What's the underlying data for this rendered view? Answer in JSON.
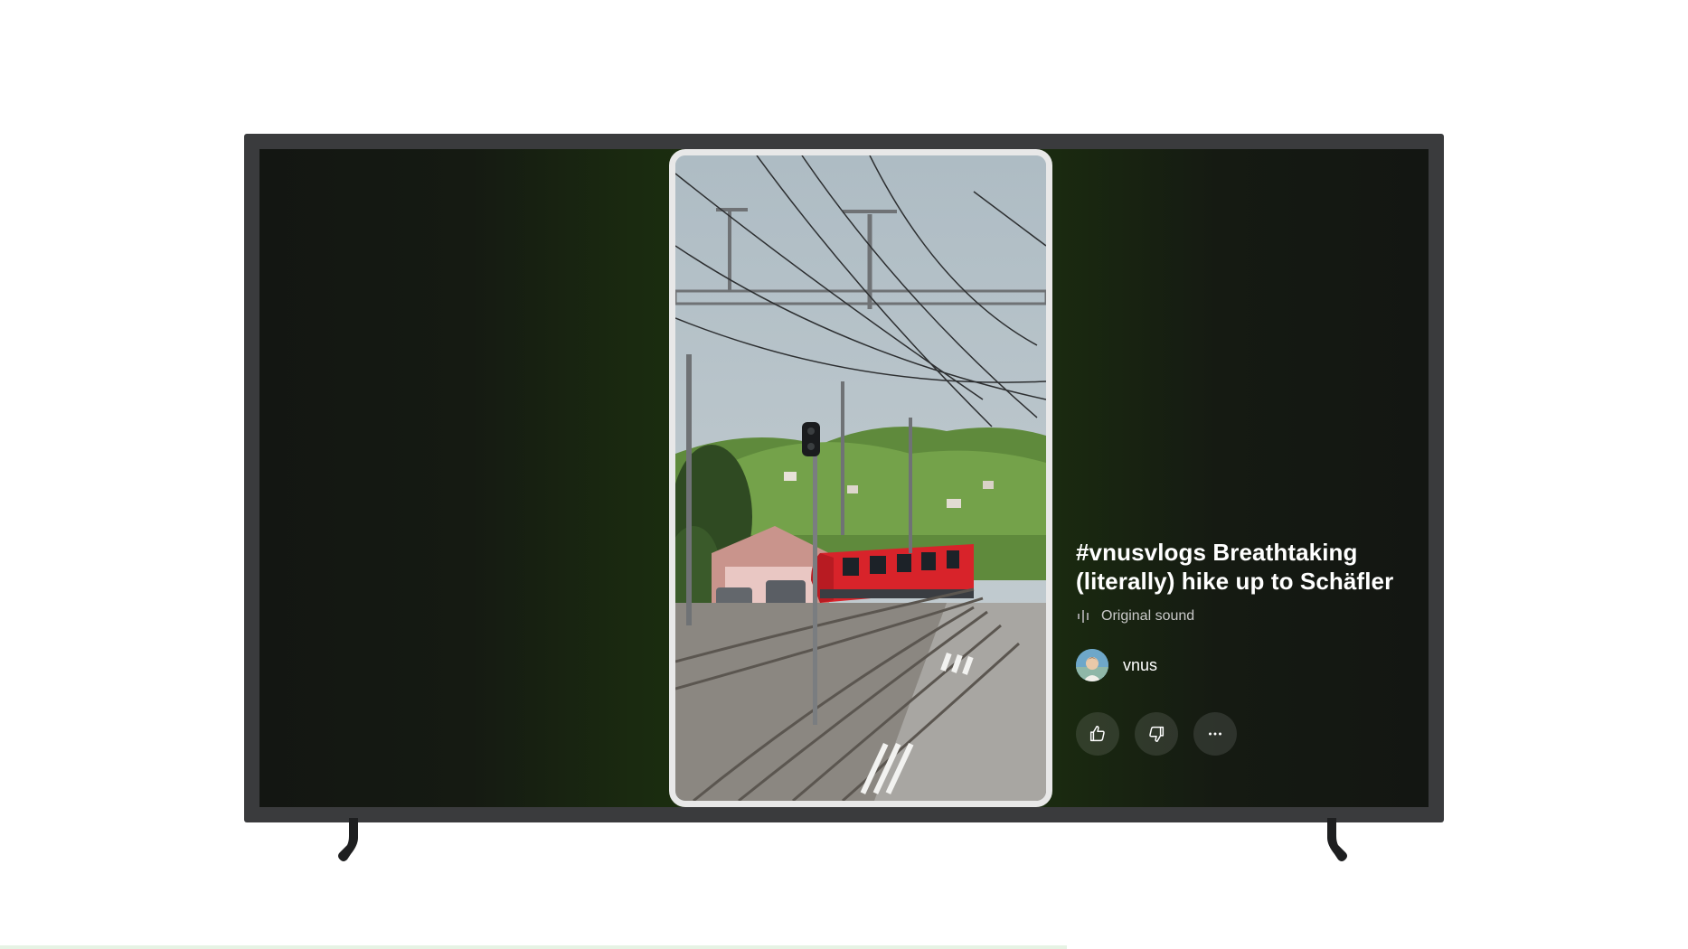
{
  "video": {
    "title": "#vnusvlogs Breathtaking (literally) hike up to Schäfler",
    "sound_label": "Original sound"
  },
  "channel": {
    "name": "vnus"
  },
  "actions": {
    "like_icon": "thumb-up-icon",
    "dislike_icon": "thumb-down-icon",
    "more_icon": "more-horizontal-icon"
  },
  "colors": {
    "bezel": "#3a3b3d",
    "screen_glow": "#1c320c",
    "train_red": "#d8232a",
    "button_bg": "rgba(255,255,255,0.11)"
  }
}
